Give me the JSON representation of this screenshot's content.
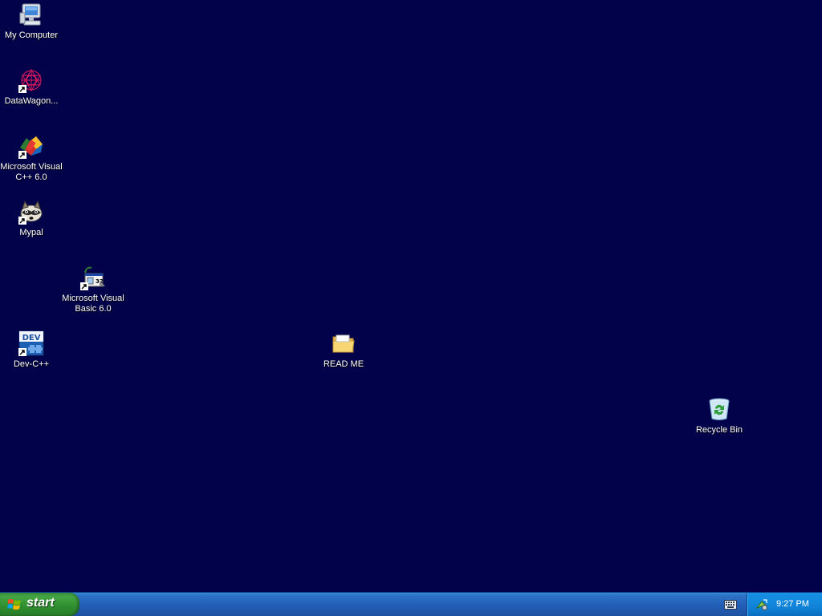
{
  "desktop": {
    "background": "#02024a",
    "icons": {
      "my_computer": {
        "label": "My Computer",
        "icon": "computer-icon"
      },
      "datawagon": {
        "label": "DataWagon...",
        "icon": "datawagon-icon"
      },
      "visual_cpp": {
        "label": "Microsoft Visual\nC++ 6.0",
        "icon": "visual-cpp-icon"
      },
      "mypal": {
        "label": "Mypal",
        "icon": "raccoon-icon"
      },
      "visual_basic": {
        "label": "Microsoft Visual\nBasic 6.0",
        "icon": "visual-basic-icon"
      },
      "dev_cpp": {
        "label": "Dev-C++",
        "icon": "dev-cpp-icon",
        "badge": "DEV"
      },
      "read_me": {
        "label": "READ ME",
        "icon": "folder-icon"
      },
      "recycle_bin": {
        "label": "Recycle Bin",
        "icon": "recycle-bin-icon"
      }
    }
  },
  "taskbar": {
    "start_label": "start",
    "clock": "9:27 PM",
    "colors": {
      "bar": "#235fb8",
      "start": "#3f9b3f",
      "tray": "#0f7fd4"
    }
  }
}
